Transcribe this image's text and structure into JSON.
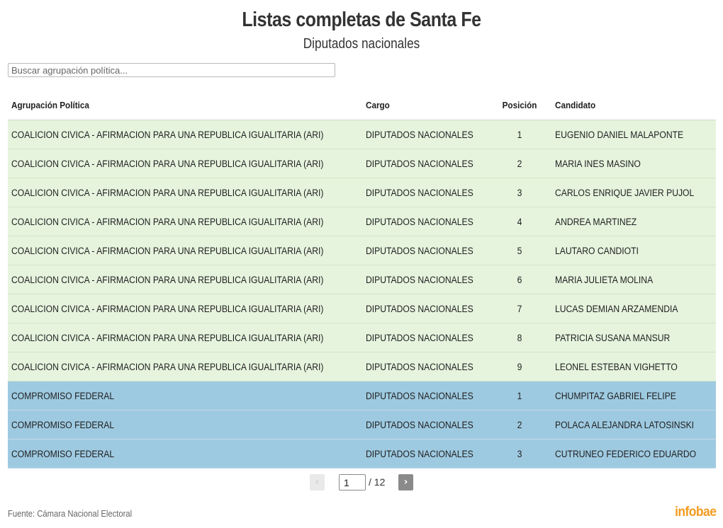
{
  "header": {
    "title": "Listas completas de Santa Fe",
    "subtitle": "Diputados nacionales"
  },
  "search": {
    "placeholder": "Buscar agrupación política..."
  },
  "table": {
    "columns": [
      "Agrupación Política",
      "Cargo",
      "Posición",
      "Candidato"
    ],
    "rows": [
      {
        "agrupacion": "COALICION CIVICA - AFIRMACION PARA UNA REPUBLICA IGUALITARIA (ARI)",
        "cargo": "DIPUTADOS NACIONALES",
        "posicion": "1",
        "candidato": "EUGENIO DANIEL MALAPONTE"
      },
      {
        "agrupacion": "COALICION CIVICA - AFIRMACION PARA UNA REPUBLICA IGUALITARIA (ARI)",
        "cargo": "DIPUTADOS NACIONALES",
        "posicion": "2",
        "candidato": "MARIA INES MASINO"
      },
      {
        "agrupacion": "COALICION CIVICA - AFIRMACION PARA UNA REPUBLICA IGUALITARIA (ARI)",
        "cargo": "DIPUTADOS NACIONALES",
        "posicion": "3",
        "candidato": "CARLOS ENRIQUE JAVIER PUJOL"
      },
      {
        "agrupacion": "COALICION CIVICA - AFIRMACION PARA UNA REPUBLICA IGUALITARIA (ARI)",
        "cargo": "DIPUTADOS NACIONALES",
        "posicion": "4",
        "candidato": "ANDREA MARTINEZ"
      },
      {
        "agrupacion": "COALICION CIVICA - AFIRMACION PARA UNA REPUBLICA IGUALITARIA (ARI)",
        "cargo": "DIPUTADOS NACIONALES",
        "posicion": "5",
        "candidato": "LAUTARO CANDIOTI"
      },
      {
        "agrupacion": "COALICION CIVICA - AFIRMACION PARA UNA REPUBLICA IGUALITARIA (ARI)",
        "cargo": "DIPUTADOS NACIONALES",
        "posicion": "6",
        "candidato": "MARIA JULIETA MOLINA"
      },
      {
        "agrupacion": "COALICION CIVICA - AFIRMACION PARA UNA REPUBLICA IGUALITARIA (ARI)",
        "cargo": "DIPUTADOS NACIONALES",
        "posicion": "7",
        "candidato": "LUCAS DEMIAN ARZAMENDIA"
      },
      {
        "agrupacion": "COALICION CIVICA - AFIRMACION PARA UNA REPUBLICA IGUALITARIA (ARI)",
        "cargo": "DIPUTADOS NACIONALES",
        "posicion": "8",
        "candidato": "PATRICIA SUSANA MANSUR"
      },
      {
        "agrupacion": "COALICION CIVICA - AFIRMACION PARA UNA REPUBLICA IGUALITARIA (ARI)",
        "cargo": "DIPUTADOS NACIONALES",
        "posicion": "9",
        "candidato": "LEONEL ESTEBAN VIGHETTO"
      },
      {
        "agrupacion": "COMPROMISO FEDERAL",
        "cargo": "DIPUTADOS NACIONALES",
        "posicion": "1",
        "candidato": "CHUMPITAZ GABRIEL FELIPE"
      },
      {
        "agrupacion": "COMPROMISO FEDERAL",
        "cargo": "DIPUTADOS NACIONALES",
        "posicion": "2",
        "candidato": "POLACA ALEJANDRA LATOSINSKI"
      },
      {
        "agrupacion": "COMPROMISO FEDERAL",
        "cargo": "DIPUTADOS NACIONALES",
        "posicion": "3",
        "candidato": "CUTRUNEO FEDERICO EDUARDO"
      }
    ],
    "group_colors": {
      "COALICION CIVICA - AFIRMACION PARA UNA REPUBLICA IGUALITARIA (ARI)": "#e6f4de",
      "COMPROMISO FEDERAL": "#9ecae1"
    }
  },
  "pagination": {
    "prev_label": "‹",
    "next_label": "›",
    "current_page": "1",
    "total_label": "/ 12"
  },
  "footer": {
    "source": "Fuente: Cámara Nacional Electoral",
    "brand": "infobae",
    "brand_color": "#f39b1f"
  }
}
